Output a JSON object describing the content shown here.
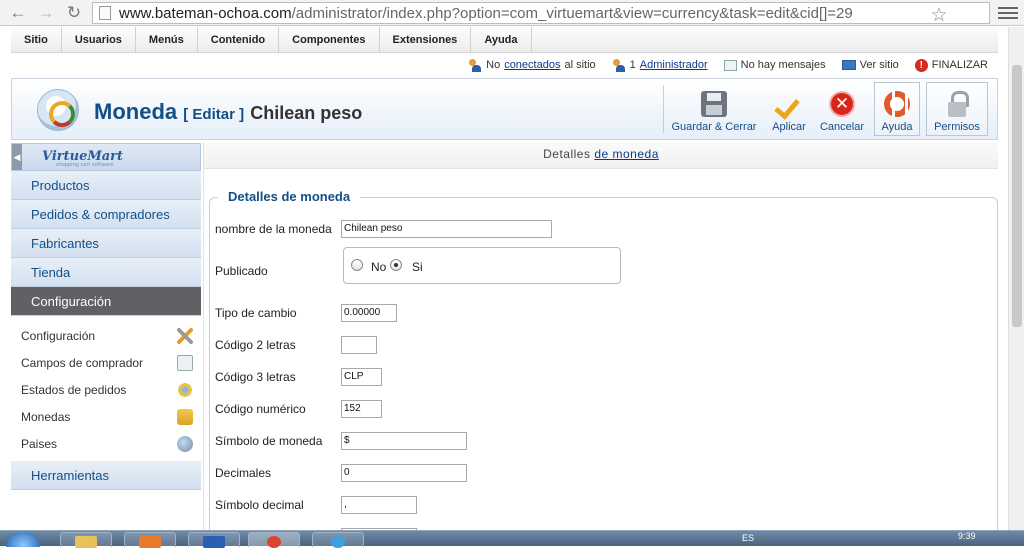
{
  "browser": {
    "back_icon": "back-arrow-icon",
    "forward_icon": "forward-arrow-icon",
    "reload_icon": "reload-icon",
    "url_host": "www.bateman-ochoa.com",
    "url_path": "/administrator/index.php?option=com_virtuemart&view=currency&task=edit&cid[]=29"
  },
  "topmenu": [
    "Sitio",
    "Usuarios",
    "Menús",
    "Contenido",
    "Componentes",
    "Extensiones",
    "Ayuda"
  ],
  "status": {
    "online_prefix": "No",
    "online_link": "conectados",
    "online_suffix": "al sitio",
    "admins_count": "1",
    "admins_link": "Administrador",
    "messages": "No hay mensajes",
    "view_site": "Ver sitio",
    "logout": "FINALIZAR"
  },
  "title": {
    "main": "Moneda",
    "action": "[ Editar ]",
    "record": "Chilean peso"
  },
  "toolbar": {
    "save_close": "Guardar & Cerrar",
    "apply": "Aplicar",
    "cancel": "Cancelar",
    "help": "Ayuda",
    "permissions": "Permisos"
  },
  "sidebar": {
    "logo": "VirtueMart",
    "logo_tag": "shopping cart software",
    "items": [
      "Productos",
      "Pedidos & compradores",
      "Fabricantes",
      "Tienda",
      "Configuración"
    ],
    "active_index": 4,
    "subitems": [
      {
        "label": "Configuración",
        "icon": "tools-icon"
      },
      {
        "label": "Campos de comprador",
        "icon": "form-fields-icon"
      },
      {
        "label": "Estados de pedidos",
        "icon": "order-states-icon"
      },
      {
        "label": "Monedas",
        "icon": "coins-icon"
      },
      {
        "label": "Paises",
        "icon": "globe-icon"
      }
    ],
    "tools": "Herramientas"
  },
  "main": {
    "tab_prefix": "Detalles",
    "tab_link": "de moneda",
    "legend": "Detalles de moneda",
    "fields": {
      "name_label": "nombre de la moneda",
      "name_value": "Chilean peso",
      "published_label": "Publicado",
      "published_no": "No",
      "published_yes": "Si",
      "published_selected": "Si",
      "rate_label": "Tipo de cambio",
      "rate_value": "0.00000",
      "code2_label": "Código 2 letras",
      "code2_value": "",
      "code3_label": "Código 3 letras",
      "code3_value": "CLP",
      "numeric_label": "Código numérico",
      "numeric_value": "152",
      "symbol_label": "Símbolo de moneda",
      "symbol_value": "$",
      "decimals_label": "Decimales",
      "decimals_value": "0",
      "decsym_label": "Símbolo decimal",
      "decsym_value": ","
    }
  },
  "taskbar": {
    "lang": "ES",
    "time": "9:39"
  }
}
